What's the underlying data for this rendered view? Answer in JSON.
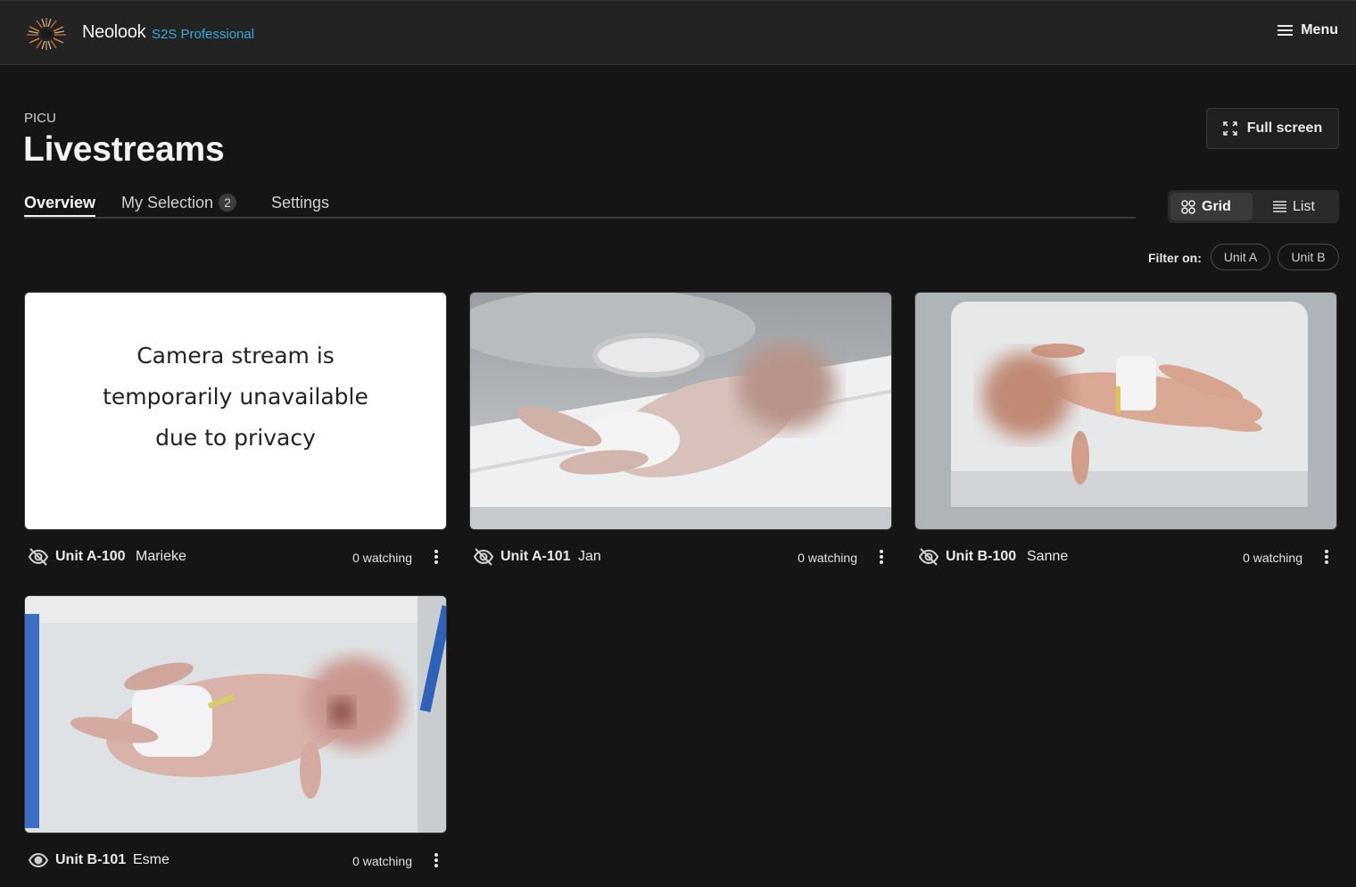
{
  "header": {
    "brand": "Neolook",
    "brand_sub": "S2S Professional",
    "menu_label": "Menu"
  },
  "page": {
    "breadcrumb": "PICU",
    "title": "Livestreams",
    "fullscreen_label": "Full screen"
  },
  "tabs": [
    {
      "label": "Overview",
      "active": true
    },
    {
      "label": "My Selection",
      "badge": "2"
    },
    {
      "label": "Settings"
    }
  ],
  "view_toggle": {
    "grid_label": "Grid",
    "list_label": "List",
    "selected": "Grid"
  },
  "filter": {
    "label": "Filter on:",
    "chips": [
      "Unit A",
      "Unit B"
    ]
  },
  "cameras": [
    {
      "unit": "Unit A-100",
      "name": "Marieke",
      "watching": "0 watching",
      "visibility_icon": "eye-off-icon",
      "unavailable_lines": [
        "Camera stream is",
        "temporarily unavailable",
        "due to privacy"
      ]
    },
    {
      "unit": "Unit A-101",
      "name": "Jan",
      "watching": "0 watching",
      "visibility_icon": "eye-off-icon"
    },
    {
      "unit": "Unit B-100",
      "name": "Sanne",
      "watching": "0 watching",
      "visibility_icon": "eye-off-icon"
    },
    {
      "unit": "Unit B-101",
      "name": "Esme",
      "watching": "0 watching",
      "visibility_icon": "eye-icon"
    }
  ],
  "colors": {
    "background": "#151515",
    "topbar": "#232323",
    "accent": "#38a9d6"
  }
}
